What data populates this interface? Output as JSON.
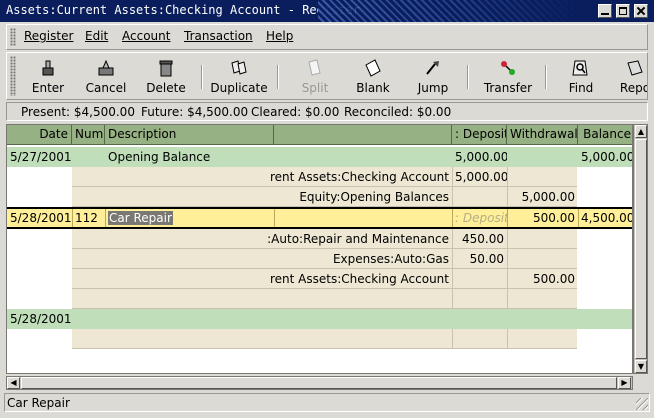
{
  "window": {
    "title": "Assets:Current Assets:Checking Account - Register"
  },
  "menu": [
    "Register",
    "Edit",
    "Account",
    "Transaction",
    "Help"
  ],
  "toolbar": {
    "enter": "Enter",
    "cancel": "Cancel",
    "delete": "Delete",
    "duplicate": "Duplicate",
    "split": "Split",
    "blank": "Blank",
    "jump": "Jump",
    "transfer": "Transfer",
    "find": "Find",
    "report": "Repo"
  },
  "summary": {
    "present": "Present: $4,500.00",
    "future": "Future: $4,500.00",
    "cleared": "Cleared: $0.00",
    "reconciled": "Reconciled: $0.00"
  },
  "columns": {
    "date": "Date",
    "num": "Num",
    "description": "Description",
    "transfer": "",
    "deposit": ": Deposit",
    "withdrawal": "Withdrawal",
    "balance": "Balance"
  },
  "transactions": [
    {
      "date": "5/27/2001",
      "num": "",
      "description": "Opening Balance",
      "deposit": "5,000.00",
      "withdrawal": "",
      "balance": "5,000.00",
      "splits": [
        {
          "account": "rent Assets:Checking Account",
          "deposit": "5,000.00",
          "withdrawal": ""
        },
        {
          "account": "Equity:Opening Balances",
          "deposit": "",
          "withdrawal": "5,000.00"
        }
      ]
    },
    {
      "date": "5/28/2001",
      "num": "112",
      "description": "Car Repair",
      "deposit_hint": ": Deposit",
      "deposit": "",
      "withdrawal": "500.00",
      "balance": "4,500.00",
      "splits": [
        {
          "account": ":Auto:Repair and Maintenance",
          "deposit": "450.00",
          "withdrawal": ""
        },
        {
          "account": "Expenses:Auto:Gas",
          "deposit": "50.00",
          "withdrawal": ""
        },
        {
          "account": "rent Assets:Checking Account",
          "deposit": "",
          "withdrawal": "500.00"
        }
      ]
    },
    {
      "date": "5/28/2001"
    }
  ],
  "status": {
    "text": "Car Repair"
  }
}
